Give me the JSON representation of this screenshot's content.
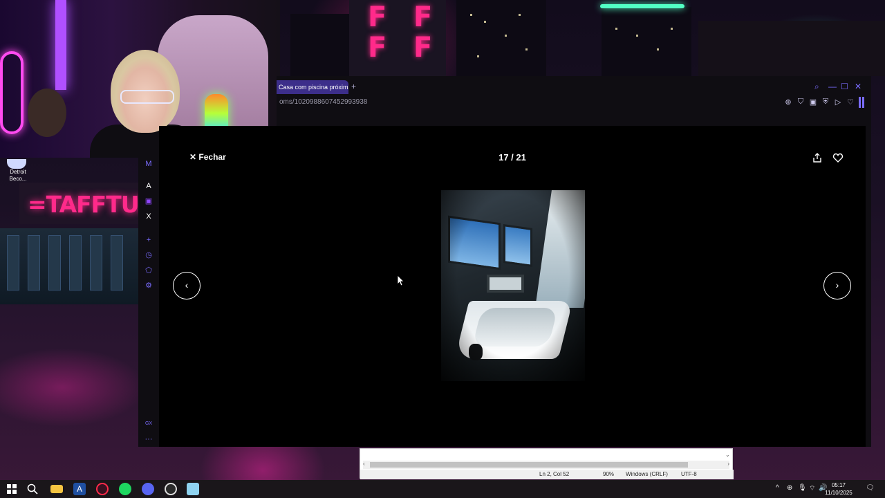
{
  "browser": {
    "tab_title": "Casa com piscina próxima",
    "new_tab": "+",
    "url": "oms/1020988607452993938"
  },
  "lightbox": {
    "close_label": "Fechar",
    "counter": "17 / 21",
    "prev": "‹",
    "next": "›"
  },
  "desktop": {
    "icon_label_line1": "Detroit",
    "icon_label_line2": "Beco...",
    "sign_text": "=TAFFTUN"
  },
  "sidebar": {
    "items": [
      "M",
      "A",
      "▣",
      "X",
      "+",
      "◷",
      "⬠",
      "⚙",
      "GX",
      "···"
    ]
  },
  "notepad": {
    "position": "Ln 2, Col 52",
    "zoom": "90%",
    "line_ending": "Windows (CRLF)",
    "encoding": "UTF-8"
  },
  "taskbar": {
    "time": "05:17",
    "date": "11/10/2025"
  },
  "colors": {
    "accent": "#7a6cff",
    "tab_active": "#3c2e8a",
    "neon_pink": "#ff2a8a"
  }
}
